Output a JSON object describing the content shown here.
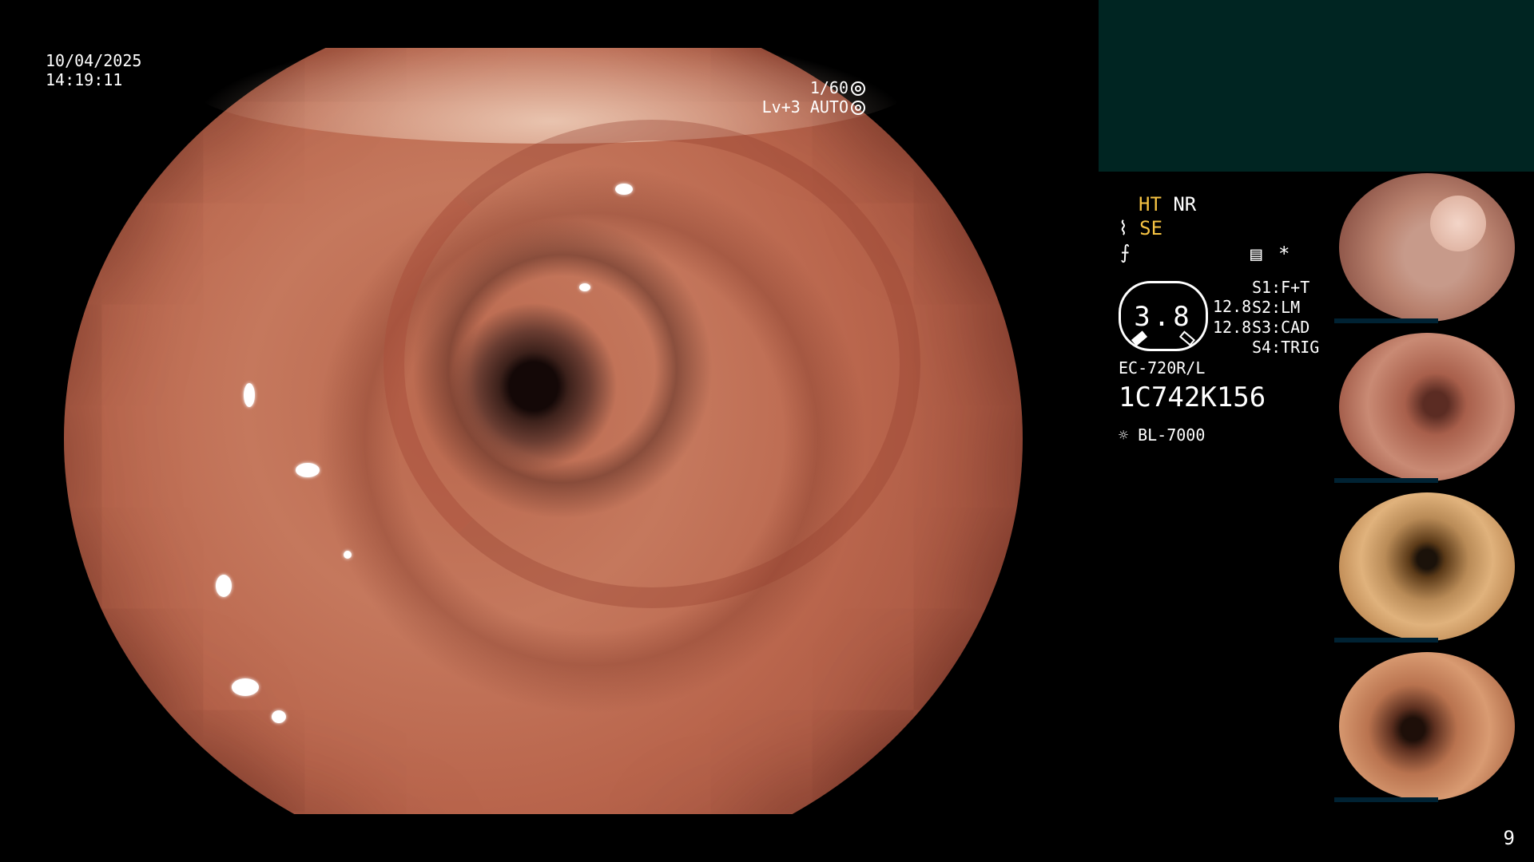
{
  "overlay": {
    "date": "10/04/2025",
    "time": "14:19:11",
    "shutter": "1/60",
    "exposure_level": "Lv+3",
    "exposure_mode": "AUTO"
  },
  "side_panel": {
    "ht": "HT",
    "nr": "NR",
    "se": "SE",
    "gauge_value": "3.8",
    "gauge_right_top": "12.8",
    "gauge_right_bottom": "12.8",
    "switches": [
      {
        "key": "S1:",
        "value": "F+T"
      },
      {
        "key": "S2:",
        "value": "LM"
      },
      {
        "key": "S3:",
        "value": "CAD"
      },
      {
        "key": "S4:",
        "value": "TRIG"
      }
    ],
    "asterisk": "*",
    "scope_model": "EC-720R/L",
    "serial": "1C742K156",
    "light_source": "BL-7000"
  },
  "thumbnails_count_label": "9",
  "icons": {
    "shutter": "shutter-icon",
    "auto": "auto-exposure-icon",
    "lamp": "lamp-icon"
  },
  "colors": {
    "accent_yellow": "#f5c242",
    "panel_teal": "#002522"
  }
}
